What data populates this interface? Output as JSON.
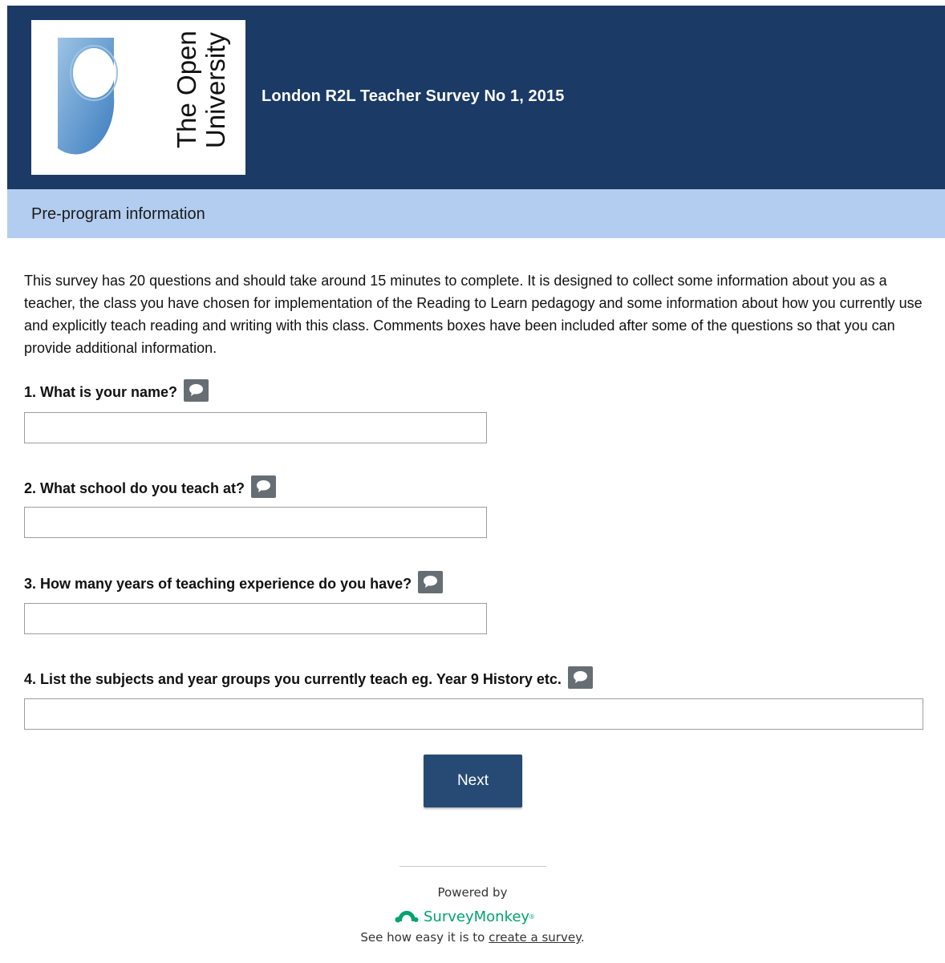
{
  "header": {
    "survey_title": "London R2L Teacher Survey No 1, 2015",
    "logo": {
      "text_line1": "The Open",
      "text_line2": "University",
      "icon": "open-university-shield-logo"
    },
    "background_color": "#1b3a66"
  },
  "page": {
    "title": "Pre-program information",
    "bar_color": "#b3cdf0"
  },
  "intro_text": "This survey has 20 questions and should take around 15 minutes to complete. It is designed to collect some information about you as a teacher, the class you have chosen for implementation of the Reading to Learn pedagogy and some information about how you currently use and explicitly teach reading and writing with this class. Comments boxes have been included after some of the questions so that you can provide additional information.",
  "questions": [
    {
      "label": "1. What is your name?",
      "value": "",
      "comment_icon": "speech-bubble-icon"
    },
    {
      "label": "2. What school do you teach at?",
      "value": "",
      "comment_icon": "speech-bubble-icon"
    },
    {
      "label": "3. How many years of teaching experience do you have?",
      "value": "",
      "comment_icon": "speech-bubble-icon"
    },
    {
      "label": "4. List the subjects and year groups you currently teach eg. Year 9 History etc.",
      "value": "",
      "comment_icon": "speech-bubble-icon"
    }
  ],
  "navigation": {
    "next_label": "Next",
    "button_color": "#264a73"
  },
  "footer": {
    "powered_by": "Powered by",
    "brand_name": "SurveyMonkey",
    "brand_reg": "®",
    "brand_color": "#00a36e",
    "see_how_prefix": "See how easy it is to",
    "create_link": "create a survey",
    "see_how_suffix": "."
  }
}
